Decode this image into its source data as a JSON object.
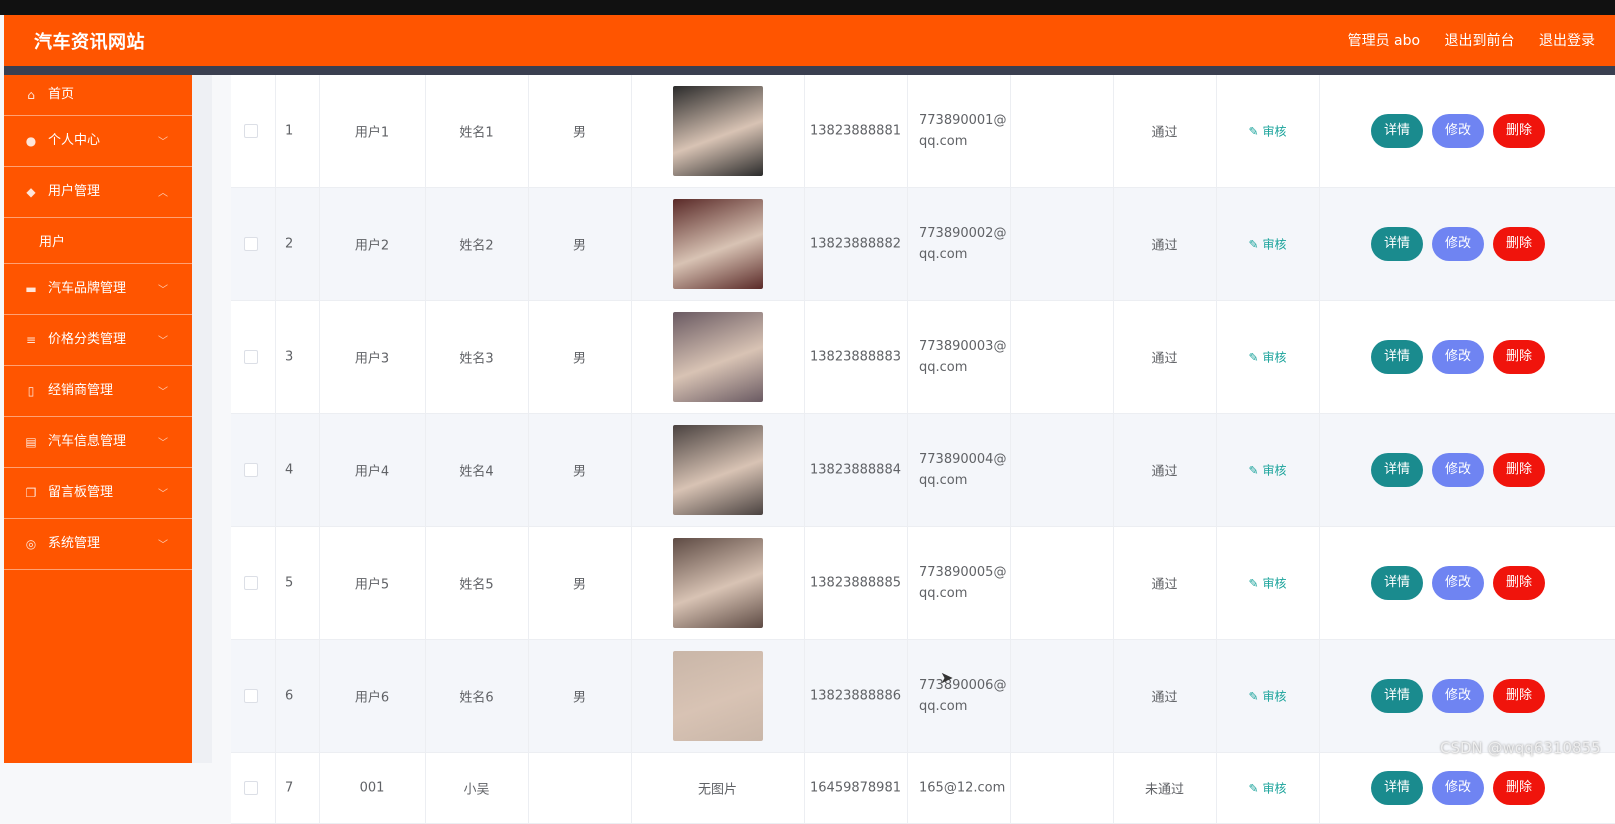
{
  "header": {
    "title": "汽车资讯网站",
    "admin": "管理员 abo",
    "to_front": "退出到前台",
    "logout": "退出登录"
  },
  "sidebar": {
    "items": [
      {
        "label": "首页",
        "icon": "home-icon",
        "glyph": "⌂"
      },
      {
        "label": "个人中心",
        "icon": "user-icon",
        "glyph": "●"
      },
      {
        "label": "用户管理",
        "icon": "shield-icon",
        "glyph": "◆",
        "expanded": true,
        "sub": "用户"
      },
      {
        "label": "汽车品牌管理",
        "icon": "car-icon",
        "glyph": "▬"
      },
      {
        "label": "价格分类管理",
        "icon": "list-icon",
        "glyph": "≡"
      },
      {
        "label": "经销商管理",
        "icon": "phone-icon",
        "glyph": "▯"
      },
      {
        "label": "汽车信息管理",
        "icon": "briefcase-icon",
        "glyph": "▤"
      },
      {
        "label": "留言板管理",
        "icon": "copy-icon",
        "glyph": "❐"
      },
      {
        "label": "系统管理",
        "icon": "compass-icon",
        "glyph": "◎"
      }
    ]
  },
  "table": {
    "audit_label": "审核",
    "buttons": {
      "detail": "详情",
      "edit": "修改",
      "delete": "删除"
    },
    "rows": [
      {
        "idx": "1",
        "account": "用户1",
        "name": "姓名1",
        "gender": "男",
        "phone": "13823888881",
        "email1": "773890001@",
        "email2": "qq.com",
        "status": "通过",
        "avatar": "#2b2b2b"
      },
      {
        "idx": "2",
        "account": "用户2",
        "name": "姓名2",
        "gender": "男",
        "phone": "13823888882",
        "email1": "773890002@",
        "email2": "qq.com",
        "status": "通过",
        "avatar": "#5a2a28"
      },
      {
        "idx": "3",
        "account": "用户3",
        "name": "姓名3",
        "gender": "男",
        "phone": "13823888883",
        "email1": "773890003@",
        "email2": "qq.com",
        "status": "通过",
        "avatar": "#6a5a62"
      },
      {
        "idx": "4",
        "account": "用户4",
        "name": "姓名4",
        "gender": "男",
        "phone": "13823888884",
        "email1": "773890004@",
        "email2": "qq.com",
        "status": "通过",
        "avatar": "#4a4240"
      },
      {
        "idx": "5",
        "account": "用户5",
        "name": "姓名5",
        "gender": "男",
        "phone": "13823888885",
        "email1": "773890005@",
        "email2": "qq.com",
        "status": "通过",
        "avatar": "#5e4b44"
      },
      {
        "idx": "6",
        "account": "用户6",
        "name": "姓名6",
        "gender": "男",
        "phone": "13823888886",
        "email1": "773890006@",
        "email2": "qq.com",
        "status": "通过",
        "avatar": "#c9b6a8"
      },
      {
        "idx": "7",
        "account": "001",
        "name": "小吴",
        "gender": "",
        "photo_text": "无图片",
        "phone": "16459878981",
        "email1": "165@12.com",
        "email2": "",
        "status": "未通过"
      }
    ]
  },
  "watermark": "CSDN @wqq6310855",
  "colors": {
    "brand": "#ff5500",
    "detail": "#1a8b8e",
    "edit": "#6f84f2",
    "delete": "#f0140c",
    "audit": "#1aa39b"
  }
}
